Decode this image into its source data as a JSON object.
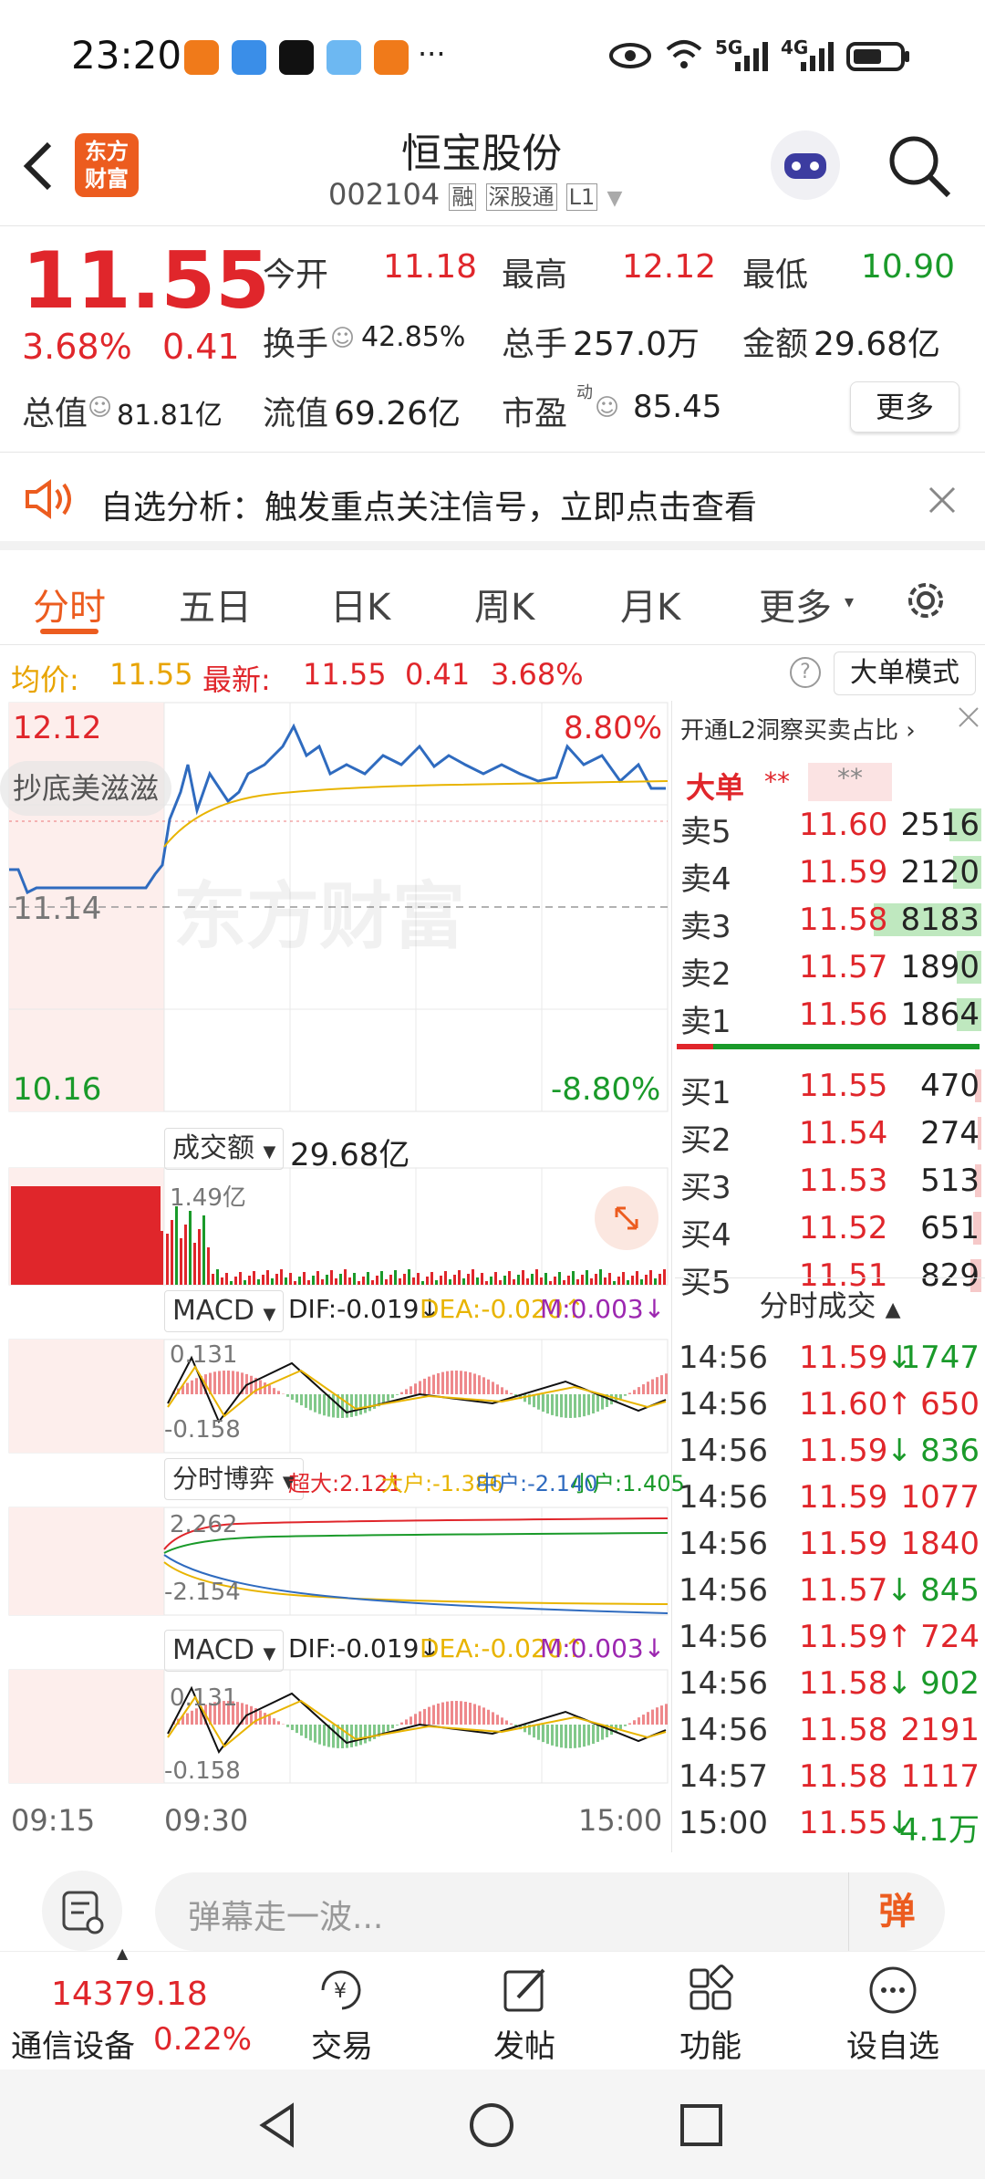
{
  "status_bar": {
    "time": "23:20",
    "more": "···",
    "signal1": "5G",
    "signal2": "4G"
  },
  "header": {
    "stock_name": "恒宝股份",
    "code": "002104",
    "tags": [
      "融",
      "深股通",
      "L1"
    ],
    "logo_line1": "东方",
    "logo_line2": "财富"
  },
  "quote": {
    "price": "11.55",
    "change_pct": "3.68%",
    "change": "0.41",
    "open_label": "今开",
    "open": "11.18",
    "high_label": "最高",
    "high": "12.12",
    "low_label": "最低",
    "low": "10.90",
    "turnover_label": "换手",
    "turnover": "42.85%",
    "volume_label": "总手",
    "volume": "257.0万",
    "amount_label": "金额",
    "amount": "29.68亿",
    "mktcap_label": "总值",
    "mktcap": "81.81亿",
    "float_label": "流值",
    "float": "69.26亿",
    "pe_label": "市盈",
    "pe_sup": "动",
    "pe": "85.45",
    "more_button": "更多"
  },
  "notice": {
    "text": "自选分析：触发重点关注信号，立即点击查看"
  },
  "tabs": [
    {
      "label": "分时",
      "active": true
    },
    {
      "label": "五日"
    },
    {
      "label": "日K"
    },
    {
      "label": "周K"
    },
    {
      "label": "月K"
    },
    {
      "label": "更多"
    }
  ],
  "infobar": {
    "avg_label": "均价:",
    "avg": "11.55",
    "latest_label": "最新:",
    "latest": "11.55",
    "chg": "0.41",
    "pct": "3.68%",
    "bigorder_button": "大单模式"
  },
  "chart": {
    "top_left": "12.12",
    "top_right": "8.80%",
    "mid_label": "11.14",
    "bottom_left": "10.16",
    "bottom_right": "-8.80%",
    "danmaku": "抄底美滋滋",
    "watermark": "东方财富",
    "vol_label": "成交额",
    "vol_value": "29.68亿",
    "vol_max": "1.49亿",
    "macd_label": "MACD",
    "dif": "DIF:-0.019↓",
    "dea": "DEA:-0.020↑",
    "m": "M:0.003↓",
    "macd_top": "0.131",
    "macd_bottom": "-0.158",
    "game_label": "分时博弈",
    "super": "超大:2.121",
    "big": "大户:-1.386",
    "mid": "中户:-2.140",
    "small": "小户:1.405",
    "game_top": "2.262",
    "game_bottom": "-2.154",
    "time_start": "09:15",
    "time_open": "09:30",
    "time_end": "15:00"
  },
  "orderbook": {
    "l2_text": "开通L2洞察买卖占比",
    "bigorder_label": "大单",
    "stars1": "**",
    "stars2": "**",
    "asks": [
      {
        "label": "卖5",
        "price": "11.60",
        "vol": "2516",
        "fill": 0.3
      },
      {
        "label": "卖4",
        "price": "11.59",
        "vol": "2120",
        "fill": 0.26
      },
      {
        "label": "卖3",
        "price": "11.58",
        "vol": "8183",
        "fill": 1.0
      },
      {
        "label": "卖2",
        "price": "11.57",
        "vol": "1890",
        "fill": 0.23
      },
      {
        "label": "卖1",
        "price": "11.56",
        "vol": "1864",
        "fill": 0.23
      }
    ],
    "bids": [
      {
        "label": "买1",
        "price": "11.55",
        "vol": "470",
        "fill": 0.06
      },
      {
        "label": "买2",
        "price": "11.54",
        "vol": "274",
        "fill": 0.03
      },
      {
        "label": "买3",
        "price": "11.53",
        "vol": "513",
        "fill": 0.06
      },
      {
        "label": "买4",
        "price": "11.52",
        "vol": "651",
        "fill": 0.08
      },
      {
        "label": "买5",
        "price": "11.51",
        "vol": "829",
        "fill": 0.1
      }
    ]
  },
  "ticks": {
    "title": "分时成交",
    "rows": [
      {
        "time": "14:56",
        "price": "11.59",
        "arrow": "↓",
        "vol": "1747",
        "dir": "down"
      },
      {
        "time": "14:56",
        "price": "11.60",
        "arrow": "↑",
        "vol": "650",
        "dir": "up"
      },
      {
        "time": "14:56",
        "price": "11.59",
        "arrow": "↓",
        "vol": "836",
        "dir": "down"
      },
      {
        "time": "14:56",
        "price": "11.59",
        "arrow": "",
        "vol": "1077",
        "dir": "up"
      },
      {
        "time": "14:56",
        "price": "11.59",
        "arrow": "",
        "vol": "1840",
        "dir": "up"
      },
      {
        "time": "14:56",
        "price": "11.57",
        "arrow": "↓",
        "vol": "845",
        "dir": "down"
      },
      {
        "time": "14:56",
        "price": "11.59",
        "arrow": "↑",
        "vol": "724",
        "dir": "up"
      },
      {
        "time": "14:56",
        "price": "11.58",
        "arrow": "↓",
        "vol": "902",
        "dir": "down"
      },
      {
        "time": "14:56",
        "price": "11.58",
        "arrow": "",
        "vol": "2191",
        "dir": "up"
      },
      {
        "time": "14:57",
        "price": "11.58",
        "arrow": "",
        "vol": "1117",
        "dir": "up"
      },
      {
        "time": "15:00",
        "price": "11.55",
        "arrow": "↓",
        "vol": "4.1万",
        "dir": "down"
      }
    ]
  },
  "comment": {
    "placeholder": "弹幕走一波...",
    "danmaku_button": "弹"
  },
  "bottom": {
    "index_value": "14379.18",
    "index_name": "通信设备",
    "index_pct": "0.22%",
    "trade": "交易",
    "post": "发帖",
    "functions": "功能",
    "watchlist": "设自选"
  },
  "colors": {
    "up": "#e0262b",
    "down": "#1a9a2a",
    "accent": "#ec5c1f",
    "price_line": "#2f6bbf",
    "avg_line": "#e8b400"
  }
}
